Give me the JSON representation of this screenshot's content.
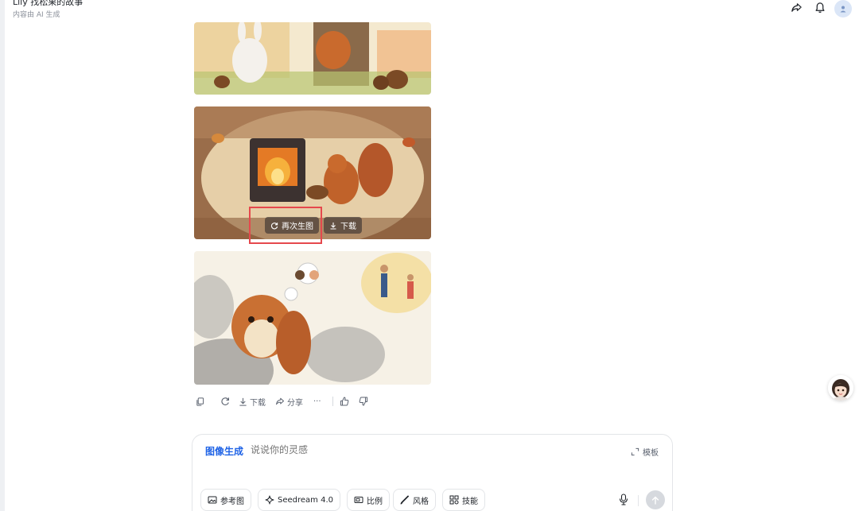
{
  "header": {
    "title": "Lily 找松果的故事",
    "subtitle": "内容由 AI 生成",
    "icons": [
      "share-icon",
      "bell-icon",
      "user-avatar"
    ]
  },
  "image_overlay": {
    "regenerate_label": "再次生图",
    "download_label": "下载"
  },
  "actions": {
    "download_label": "下载",
    "share_label": "分享",
    "more_label": "···"
  },
  "composer": {
    "mode_label": "图像生成",
    "placeholder": "说说你的灵感",
    "template_label": "模板",
    "chips": {
      "reference": "参考图",
      "model": "Seedream 4.0",
      "ratio": "比例",
      "style": "风格",
      "skill": "技能"
    }
  },
  "colors": {
    "accent": "#1f63e6",
    "highlight": "#e5484d"
  }
}
